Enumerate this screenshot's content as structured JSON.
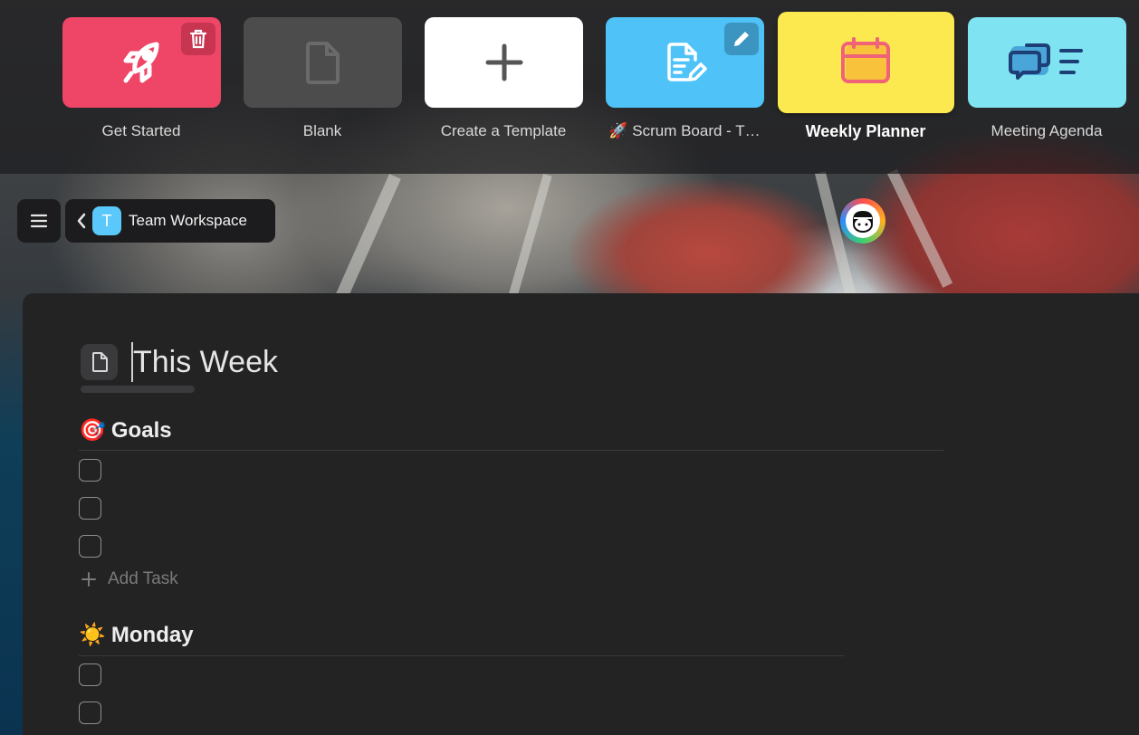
{
  "templates": [
    {
      "label": "Get Started",
      "bg": "#ef4566",
      "icon": "rocket-icon",
      "corner": "trash-icon",
      "selected": false
    },
    {
      "label": "Blank",
      "bg": "#4c4c4c",
      "icon": "document-icon",
      "selected": false
    },
    {
      "label": "Create a Template",
      "bg": "#ffffff",
      "icon": "plus-icon",
      "selected": false
    },
    {
      "label": "🚀 Scrum Board - T…",
      "bg": "#4fc3f7",
      "icon": "document-edit-icon",
      "corner": "pencil-icon",
      "selected": false
    },
    {
      "label": "Weekly Planner",
      "bg": "#fce94f",
      "icon": "calendar-icon",
      "selected": true
    },
    {
      "label": "Meeting Agenda",
      "bg": "#7fe3f2",
      "icon": "chat-bubbles-icon",
      "selected": false
    }
  ],
  "workspace": {
    "initial": "T",
    "name": "Team Workspace"
  },
  "document": {
    "title": "This Week"
  },
  "sections": [
    {
      "emoji": "🎯",
      "title": "Goals",
      "tasks": 3,
      "add_label": "Add Task"
    },
    {
      "emoji": "☀️",
      "title": "Monday",
      "tasks": 2
    }
  ],
  "colors": {
    "accent": "#4fc3f7",
    "danger": "#ef4566",
    "doc_bg": "#232323"
  }
}
